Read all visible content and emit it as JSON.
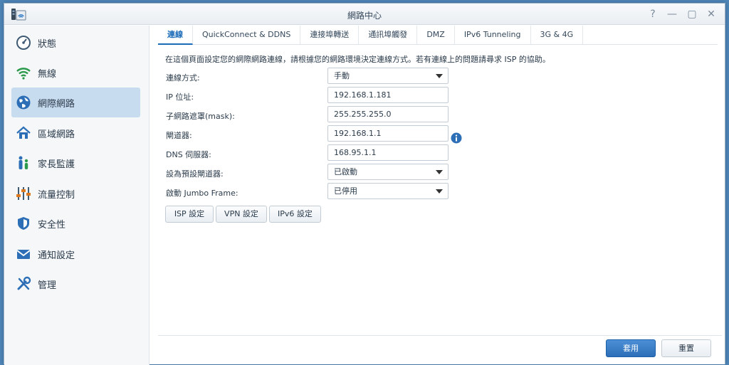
{
  "window": {
    "title": "網路中心",
    "controls": [
      "?",
      "—",
      "▢",
      "✕"
    ]
  },
  "sidebar": {
    "items": [
      {
        "label": "狀態",
        "icon": "gauge-icon"
      },
      {
        "label": "無線",
        "icon": "wifi-icon"
      },
      {
        "label": "網際網路",
        "icon": "globe-icon",
        "active": true
      },
      {
        "label": "區域網路",
        "icon": "home-network-icon"
      },
      {
        "label": "家長監護",
        "icon": "family-icon"
      },
      {
        "label": "流量控制",
        "icon": "sliders-icon"
      },
      {
        "label": "安全性",
        "icon": "shield-icon"
      },
      {
        "label": "通知設定",
        "icon": "mail-icon"
      },
      {
        "label": "管理",
        "icon": "tools-icon"
      }
    ]
  },
  "tabs": [
    {
      "label": "連線",
      "active": true
    },
    {
      "label": "QuickConnect & DDNS"
    },
    {
      "label": "連接埠轉送"
    },
    {
      "label": "通訊埠觸發"
    },
    {
      "label": "DMZ"
    },
    {
      "label": "IPv6 Tunneling"
    },
    {
      "label": "3G & 4G"
    }
  ],
  "description": "在這個頁面設定您的網際網路連線，請根據您的網路環境決定連線方式。若有連線上的問題請尋求 ISP 的協助。",
  "form": [
    {
      "label": "連線方式:",
      "value": "手動",
      "type": "select"
    },
    {
      "label": "IP 位址:",
      "value": "192.168.1.181",
      "type": "text"
    },
    {
      "label": "子網路遮罩(mask):",
      "value": "255.255.255.0",
      "type": "text"
    },
    {
      "label": "閘道器:",
      "value": "192.168.1.1",
      "type": "text"
    },
    {
      "label": "DNS 伺服器:",
      "value": "168.95.1.1",
      "type": "text"
    },
    {
      "label": "設為預設閘道器:",
      "value": "已啟動",
      "type": "select"
    },
    {
      "label": "啟動 Jumbo Frame:",
      "value": "已停用",
      "type": "select"
    }
  ],
  "buttons": {
    "isp": "ISP 設定",
    "vpn": "VPN 設定",
    "ipv6": "IPv6 設定"
  },
  "footer": {
    "apply": "套用",
    "reset": "重置"
  },
  "colors": {
    "accent": "#1b6bb8",
    "sidebar_active": "#c8dcef",
    "desktop": "#4f86b8"
  }
}
